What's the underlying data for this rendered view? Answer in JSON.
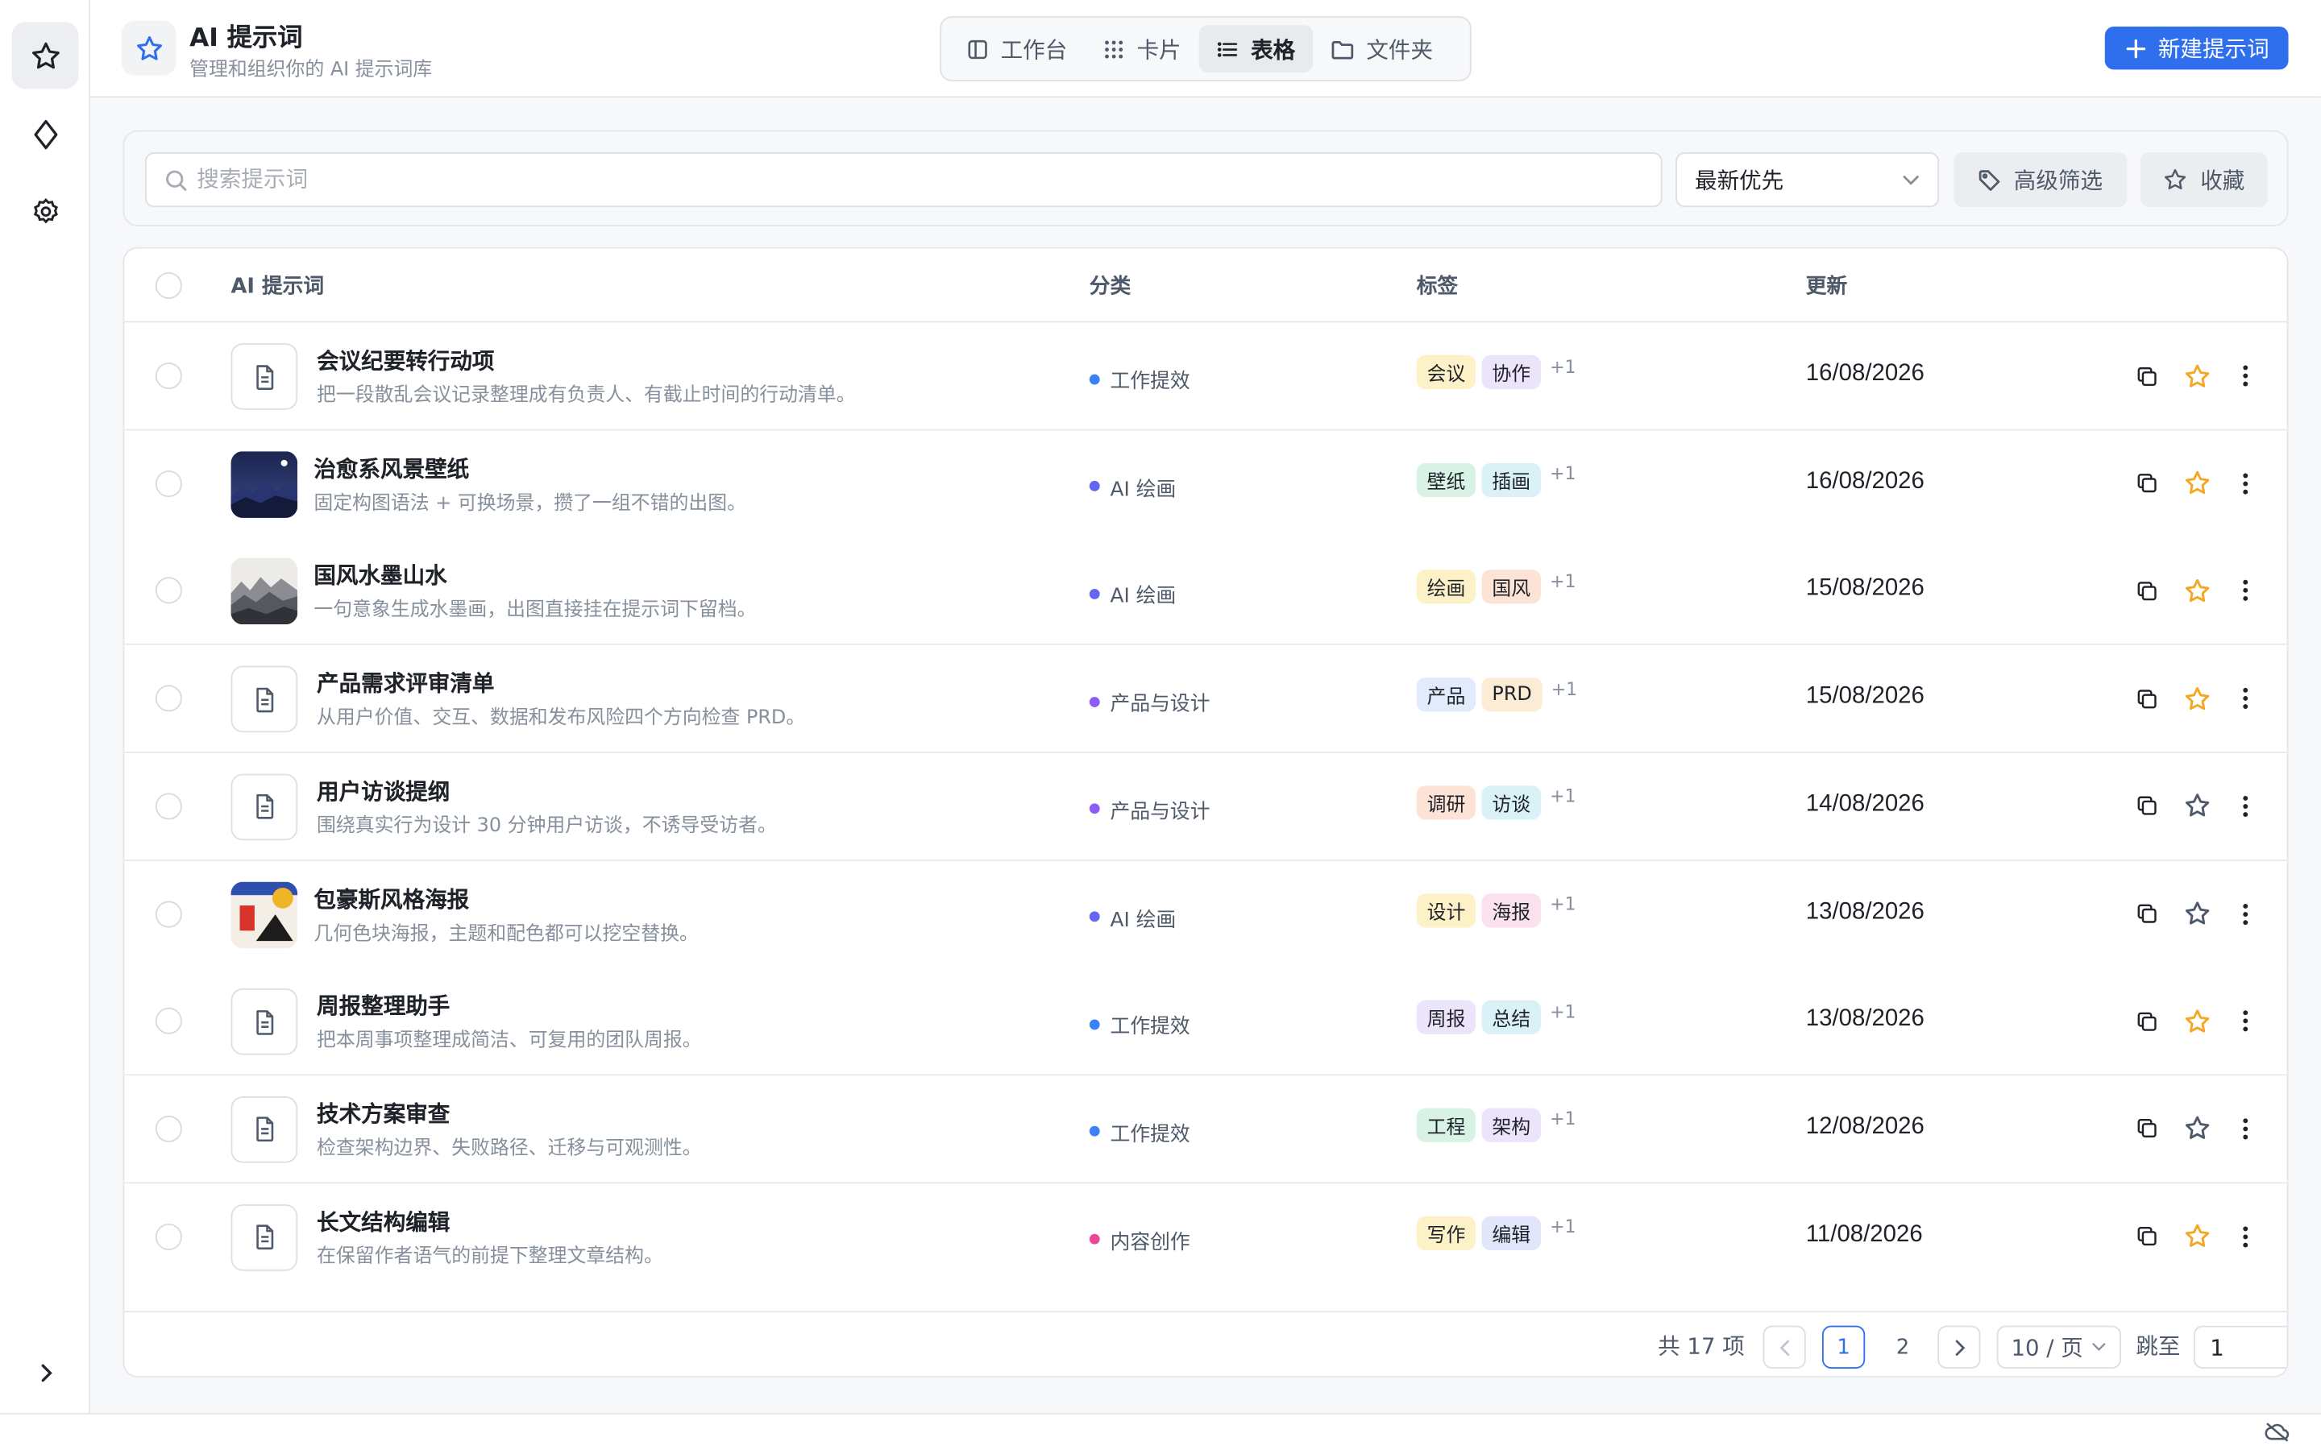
{
  "header": {
    "title": "AI 提示词",
    "subtitle": "管理和组织你的 AI 提示词库",
    "new_button": "新建提示词"
  },
  "view_tabs": [
    {
      "label": "工作台",
      "icon": "sidebar-panel-icon"
    },
    {
      "label": "卡片",
      "icon": "grid-dots-icon"
    },
    {
      "label": "表格",
      "icon": "list-icon",
      "active": true
    },
    {
      "label": "文件夹",
      "icon": "folder-icon"
    }
  ],
  "filters": {
    "search_placeholder": "搜索提示词",
    "sort_value": "最新优先",
    "advanced_label": "高级筛选",
    "favorites_label": "收藏"
  },
  "table": {
    "headers": {
      "name": "AI 提示词",
      "category": "分类",
      "tags": "标签",
      "updated": "更新"
    },
    "rows": [
      {
        "title": "会议纪要转行动项",
        "desc": "把一段散乱会议记录整理成有负责人、有截止时间的行动清单。",
        "thumb": "doc",
        "category": "工作提效",
        "tags": [
          "会议",
          "协作"
        ],
        "more": "+1",
        "date": "16/08/2026",
        "starred": true
      },
      {
        "title": "治愈系风景壁纸",
        "desc": "固定构图语法 + 可换场景，攒了一组不错的出图。",
        "thumb": "night",
        "category": "AI 绘画",
        "tags": [
          "壁纸",
          "插画"
        ],
        "more": "+1",
        "date": "16/08/2026",
        "starred": true
      },
      {
        "title": "国风水墨山水",
        "desc": "一句意象生成水墨画，出图直接挂在提示词下留档。",
        "thumb": "ink",
        "category": "AI 绘画",
        "tags": [
          "绘画",
          "国风"
        ],
        "more": "+1",
        "date": "15/08/2026",
        "starred": true
      },
      {
        "title": "产品需求评审清单",
        "desc": "从用户价值、交互、数据和发布风险四个方向检查 PRD。",
        "thumb": "doc",
        "category": "产品与设计",
        "tags": [
          "产品",
          "PRD"
        ],
        "more": "+1",
        "date": "15/08/2026",
        "starred": true
      },
      {
        "title": "用户访谈提纲",
        "desc": "围绕真实行为设计 30 分钟用户访谈，不诱导受访者。",
        "thumb": "doc",
        "category": "产品与设计",
        "tags": [
          "调研",
          "访谈"
        ],
        "more": "+1",
        "date": "14/08/2026",
        "starred": false
      },
      {
        "title": "包豪斯风格海报",
        "desc": "几何色块海报，主题和配色都可以挖空替换。",
        "thumb": "bauhaus",
        "category": "AI 绘画",
        "tags": [
          "设计",
          "海报"
        ],
        "more": "+1",
        "date": "13/08/2026",
        "starred": false
      },
      {
        "title": "周报整理助手",
        "desc": "把本周事项整理成简洁、可复用的团队周报。",
        "thumb": "doc",
        "category": "工作提效",
        "tags": [
          "周报",
          "总结"
        ],
        "more": "+1",
        "date": "13/08/2026",
        "starred": true
      },
      {
        "title": "技术方案审查",
        "desc": "检查架构边界、失败路径、迁移与可观测性。",
        "thumb": "doc",
        "category": "工作提效",
        "tags": [
          "工程",
          "架构"
        ],
        "more": "+1",
        "date": "12/08/2026",
        "starred": false
      },
      {
        "title": "长文结构编辑",
        "desc": "在保留作者语气的前提下整理文章结构。",
        "thumb": "doc",
        "category": "内容创作",
        "tags": [
          "写作",
          "编辑"
        ],
        "more": "+1",
        "date": "11/08/2026",
        "starred": true
      }
    ]
  },
  "category_colors": {
    "工作提效": "#3b82f6",
    "AI 绘画": "#6366f1",
    "产品与设计": "#8b5cf6",
    "内容创作": "#ec4899"
  },
  "tag_colors": {
    "会议": "#fdf1c7",
    "协作": "#ece4fb",
    "壁纸": "#d8f3e6",
    "插画": "#d9f1f7",
    "绘画": "#fdf1c7",
    "国风": "#fde3d6",
    "产品": "#e1ebfb",
    "PRD": "#fdecd5",
    "调研": "#fde3d6",
    "访谈": "#d9f1f7",
    "设计": "#fdf1c7",
    "海报": "#fbe1ee",
    "周报": "#ece4fb",
    "总结": "#d9f1f7",
    "工程": "#d8f3e6",
    "架构": "#ece4fb",
    "写作": "#fdf1c7",
    "编辑": "#e1e6fb"
  },
  "pagination": {
    "total": "共 17 项",
    "pages": [
      "1",
      "2"
    ],
    "current": "1",
    "page_size": "10 / 页",
    "jump_label": "跳至",
    "jump_value": "1"
  },
  "colors": {
    "accent": "#2f6fed",
    "star": "#f5a623"
  }
}
